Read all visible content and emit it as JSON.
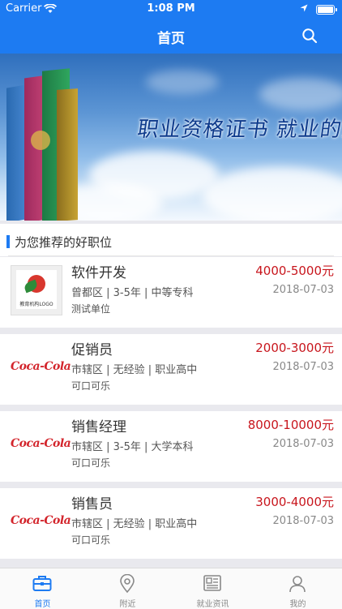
{
  "status_bar": {
    "carrier": "Carrier",
    "time": "1:08 PM"
  },
  "nav": {
    "title": "首页",
    "search_icon": "search-icon"
  },
  "banner": {
    "slogan": "职业资格证书 就业的通行证"
  },
  "section": {
    "title": "为您推荐的好职位"
  },
  "jobs": [
    {
      "title": "软件开发",
      "salary": "4000-5000元",
      "meta": "曾都区 | 3-5年 | 中等专科",
      "date": "2018-07-03",
      "company": "测试单位",
      "logo_text": "教育机构LOGO",
      "logo_type": "edu"
    },
    {
      "title": "促销员",
      "salary": "2000-3000元",
      "meta": "市辖区 | 无经验 | 职业高中",
      "date": "2018-07-03",
      "company": "可口可乐",
      "logo_text": "Coca-Cola",
      "logo_type": "coke"
    },
    {
      "title": "销售经理",
      "salary": "8000-10000元",
      "meta": "市辖区 | 3-5年 | 大学本科",
      "date": "2018-07-03",
      "company": "可口可乐",
      "logo_text": "Coca-Cola",
      "logo_type": "coke"
    },
    {
      "title": "销售员",
      "salary": "3000-4000元",
      "meta": "市辖区 | 无经验 | 职业高中",
      "date": "2018-07-03",
      "company": "可口可乐",
      "logo_text": "Coca-Cola",
      "logo_type": "coke"
    }
  ],
  "tabs": [
    {
      "label": "首页",
      "icon": "briefcase-icon",
      "active": true
    },
    {
      "label": "附近",
      "icon": "location-pin-icon",
      "active": false
    },
    {
      "label": "就业资讯",
      "icon": "news-icon",
      "active": false
    },
    {
      "label": "我的",
      "icon": "person-icon",
      "active": false
    }
  ],
  "colors": {
    "primary": "#1d7bf2",
    "salary": "#c8161d",
    "brand_red": "#d3252c"
  }
}
